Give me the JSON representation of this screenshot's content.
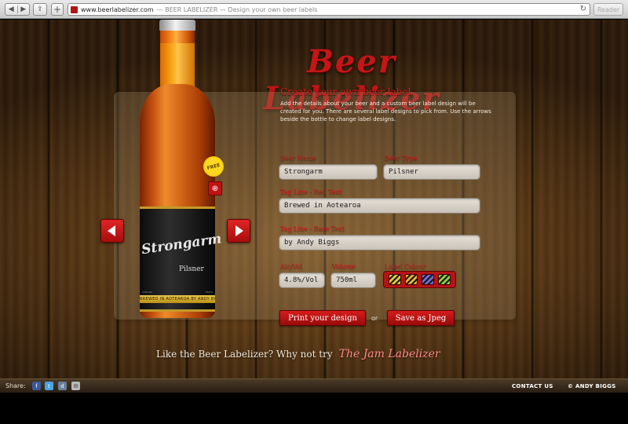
{
  "browser": {
    "back_glyph": "◀",
    "forward_glyph": "▶",
    "share_glyph": "⇪",
    "newtab_glyph": "+",
    "url": "www.beerlabelizer.com",
    "page_title": "— BEER LABELIZER — Design your own beer labels",
    "reload_glyph": "↻",
    "reader_label": "Reader"
  },
  "header": {
    "logo_text": "Beer Labelizer"
  },
  "bottle": {
    "label_name": "Strongarm",
    "label_style": "Pilsner",
    "label_abv": "4.8%/Vol",
    "label_volume": "750ml",
    "label_strip_text": "BREWED IN AOTEAROA BY ANDY BIGGS",
    "free_badge": "FREE",
    "zoom_glyph": "⊕"
  },
  "form": {
    "heading": "Create your own beer label",
    "intro": "Add the details about your beer and a custom beer label design will be created for you. There are several label designs to pick from. Use the arrows beside the bottle to change label designs.",
    "beer_name_label": "Beer Name",
    "beer_name_value": "Strongarm",
    "beer_type_label": "Beer Type",
    "beer_type_value": "Pilsner",
    "tagline_top_label": "Tag Line - Red Text",
    "tagline_top_value": "Brewed in Aotearoa",
    "tagline_bottom_label": "Tag Line - Base Text",
    "tagline_bottom_value": "by Andy Biggs",
    "abv_label": "Alc/Vol",
    "abv_value": "4.8%/Vol",
    "volume_label": "Volume",
    "volume_value": "750ml",
    "colour_label": "Label Colour",
    "swatch_colors": [
      "#e0c640",
      "#e6b23a",
      "#6f6bd4",
      "#8fcf3f"
    ],
    "print_label": "Print your design",
    "or_text": "or",
    "save_label": "Save as Jpeg"
  },
  "promo": {
    "text": "Like the Beer Labelizer? Why not try",
    "link_text": "The Jam Labelizer"
  },
  "footer": {
    "share_label": "Share:",
    "facebook_glyph": "f",
    "twitter_glyph": "t",
    "digg_glyph": "d",
    "email_glyph": "✉",
    "contact_label": "CONTACT US",
    "copyright": "© ANDY BIGGS"
  },
  "colors": {
    "accent_red": "#c41616",
    "wood_dark": "#2b190a",
    "wood_light": "#8a5b24"
  }
}
